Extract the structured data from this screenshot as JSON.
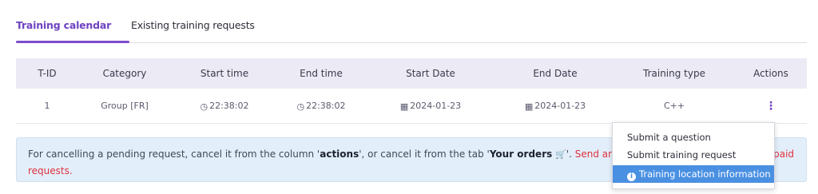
{
  "tabs": [
    {
      "label": "Training calendar",
      "active": true
    },
    {
      "label": "Existing training requests",
      "active": false
    }
  ],
  "table": {
    "headers": [
      "T-ID",
      "Category",
      "Start time",
      "End time",
      "Start Date",
      "End Date",
      "Training type",
      "Actions"
    ],
    "rows": [
      {
        "tid": "1",
        "category": "Group [FR]",
        "start_time": "22:38:02",
        "end_time": "22:38:02",
        "start_date": "2024-01-23",
        "end_date": "2024-01-23",
        "training_type": "C++",
        "actions": "⋮"
      }
    ]
  },
  "notice": {
    "part1": "For cancelling a pending request, cancel it from the column '",
    "actions_word": "actions",
    "part2": "', or cancel it from the tab '",
    "your_orders": "Your orders",
    "part3": "'. ",
    "red_text": "Send an email to cancel and refund your paid requests."
  },
  "dropdown": {
    "items": [
      "Submit a question",
      "Submit training request",
      "Training location information"
    ]
  },
  "icons": {
    "clock": "clock-icon",
    "calendar": "calendar-icon",
    "cart": "cart-icon",
    "info": "info-icon",
    "kebab": "kebab-menu-icon"
  },
  "colors": {
    "accent": "#7c4dcc",
    "header_bg": "#ecebf5",
    "notice_bg": "#e2eef9",
    "alert_red": "#e0323d",
    "selected_item": "#4a90e2"
  }
}
